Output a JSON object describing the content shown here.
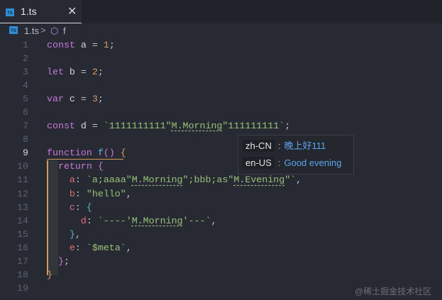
{
  "tab": {
    "label": "1.ts",
    "file_icon": "ts-file-icon",
    "close_icon": "close-icon"
  },
  "breadcrumb": {
    "file": "1.ts",
    "separator": ">",
    "symbol": "f",
    "symbol_icon": "cube-icon"
  },
  "active_line": 9,
  "lines": [
    [
      [
        "const ",
        "kw"
      ],
      [
        "a",
        "var"
      ],
      [
        " = ",
        "pun"
      ],
      [
        "1",
        "num"
      ],
      [
        ";",
        "pun"
      ]
    ],
    [],
    [
      [
        "let ",
        "kw"
      ],
      [
        "b",
        "var"
      ],
      [
        " = ",
        "pun"
      ],
      [
        "2",
        "num"
      ],
      [
        ";",
        "pun"
      ]
    ],
    [],
    [
      [
        "var ",
        "kw"
      ],
      [
        "c",
        "var"
      ],
      [
        " = ",
        "pun"
      ],
      [
        "3",
        "num"
      ],
      [
        ";",
        "pun"
      ]
    ],
    [],
    [
      [
        "const ",
        "kw"
      ],
      [
        "d",
        "var"
      ],
      [
        " = ",
        "pun"
      ],
      [
        "`1111111111\"",
        "str"
      ],
      [
        "M.Morning",
        "str u"
      ],
      [
        "\"111111111`",
        "str"
      ],
      [
        ";",
        "pun"
      ]
    ],
    [],
    [
      [
        "function ",
        "kw"
      ],
      [
        "f",
        "fn"
      ],
      [
        "() ",
        "br2"
      ],
      [
        "{",
        "br"
      ]
    ],
    [
      [
        "  return ",
        "kw"
      ],
      [
        "{",
        "br2"
      ]
    ],
    [
      [
        "    a",
        "prop"
      ],
      [
        ": ",
        "pun"
      ],
      [
        "`a;aaaa\"",
        "str"
      ],
      [
        "M.Morning",
        "str u"
      ],
      [
        "\";bbb;as\"",
        "str"
      ],
      [
        "M.Evening",
        "str u"
      ],
      [
        "\"`",
        "str"
      ],
      [
        ",",
        "pun"
      ]
    ],
    [
      [
        "    b",
        "prop"
      ],
      [
        ": ",
        "pun"
      ],
      [
        "\"hello\"",
        "str"
      ],
      [
        ",",
        "pun"
      ]
    ],
    [
      [
        "    c",
        "prop"
      ],
      [
        ": ",
        "pun"
      ],
      [
        "{",
        "br3"
      ]
    ],
    [
      [
        "      d",
        "prop"
      ],
      [
        ": ",
        "pun"
      ],
      [
        "`----'",
        "str"
      ],
      [
        "M.Morning",
        "str u"
      ],
      [
        "'---`",
        "str"
      ],
      [
        ",",
        "pun"
      ]
    ],
    [
      [
        "    }",
        "br3"
      ],
      [
        ",",
        "pun"
      ]
    ],
    [
      [
        "    e",
        "prop"
      ],
      [
        ": ",
        "pun"
      ],
      [
        "`$meta`",
        "str"
      ],
      [
        ",",
        "pun"
      ]
    ],
    [
      [
        "  }",
        "br2"
      ],
      [
        ";",
        "pun"
      ]
    ],
    [
      [
        "}",
        "br"
      ]
    ],
    []
  ],
  "hover": {
    "entries": [
      {
        "locale": "zh-CN",
        "value": "晚上好111"
      },
      {
        "locale": "en-US",
        "value": "Good evening"
      }
    ],
    "separator": ":"
  },
  "watermark": "@稀土掘金技术社区"
}
